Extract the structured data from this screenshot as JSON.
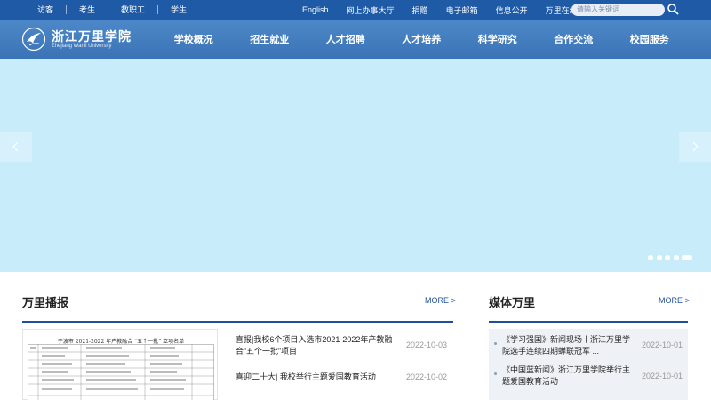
{
  "topbar": {
    "left_links": [
      "访客",
      "考生",
      "教职工",
      "学生"
    ],
    "right_links": [
      "English",
      "网上办事大厅",
      "捐赠",
      "电子邮箱",
      "信息公开",
      "万里在线"
    ],
    "search_placeholder": "请输入关键词"
  },
  "logo": {
    "name_cn": "浙江万里学院",
    "name_en": "Zhejiang Wanli University"
  },
  "nav": [
    "学校概况",
    "招生就业",
    "人才招聘",
    "人才培养",
    "科学研究",
    "合作交流",
    "校园服务"
  ],
  "banner": {
    "slide_count": 5,
    "active_slide": 5
  },
  "news": {
    "title": "万里播报",
    "more": "MORE >",
    "thumbnail_caption": "宁波市 2021-2022 年产教融合 “五个一批” 立项名单",
    "items": [
      {
        "text": "喜报|我校6个项目入选市2021-2022年产教融合“五个一批”项目",
        "date": "2022-10-03"
      },
      {
        "text": "喜迎二十大| 我校举行主题爱国教育活动",
        "date": "2022-10-02"
      }
    ]
  },
  "media": {
    "title": "媒体万里",
    "more": "MORE >",
    "items": [
      {
        "text": "《学习强国》新闻现场丨浙江万里学院选手连续四期蝉联冠军 ...",
        "date": "2022-10-01"
      },
      {
        "text": "《中国蓝新闻》浙江万里学院举行主题爱国教育活动",
        "date": "2022-10-01"
      }
    ]
  }
}
